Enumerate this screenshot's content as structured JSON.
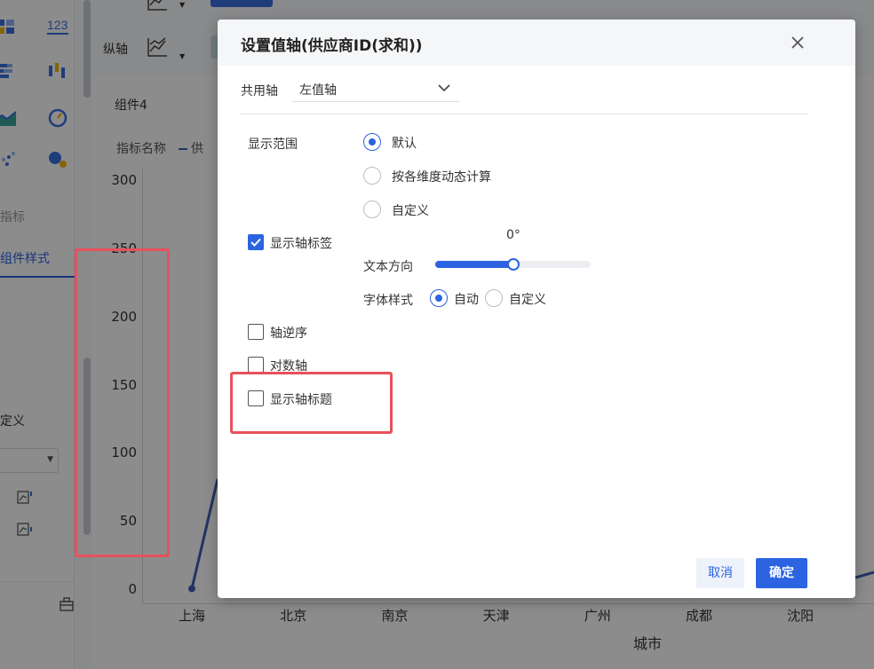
{
  "background": {
    "left_panel": {
      "chart_types_label": "123",
      "tab_metrics": "指标",
      "tab_style": "组件样式",
      "custom_text": "定义"
    },
    "config_bar": {
      "vertical_axis_label": "纵轴"
    },
    "chart": {
      "component_title": "组件4",
      "legend_label": "指标名称",
      "legend_series_prefix": "供"
    }
  },
  "chart_data": {
    "type": "line",
    "categories": [
      "上海",
      "北京",
      "南京",
      "天津",
      "广州",
      "成都",
      "沈阳"
    ],
    "xlabel": "城市",
    "ylabel": "",
    "yticks": [
      "300",
      "250",
      "200",
      "150",
      "100",
      "50",
      "0"
    ],
    "ylim": [
      0,
      300
    ],
    "series": [
      {
        "points": [
          {
            "x": "上海",
            "y": 1
          }
        ]
      }
    ],
    "line_color": "#3f5fb5"
  },
  "dialog": {
    "title": "设置值轴(供应商ID(求和))",
    "shared_axis": {
      "label": "共用轴",
      "value": "左值轴"
    },
    "display_range": {
      "label": "显示范围",
      "options": [
        "默认",
        "按各维度动态计算",
        "自定义"
      ],
      "selected": "默认"
    },
    "show_axis_labels": {
      "label": "显示轴标签",
      "checked": true
    },
    "text_direction": {
      "label": "文本方向",
      "value": "0°",
      "fraction": 0.5
    },
    "font_style": {
      "label": "字体样式",
      "options": [
        "自动",
        "自定义"
      ],
      "selected": "自动"
    },
    "axis_reverse": {
      "label": "轴逆序",
      "checked": false
    },
    "log_axis": {
      "label": "对数轴",
      "checked": false
    },
    "show_axis_title": {
      "label": "显示轴标题",
      "checked": false
    },
    "cancel_label": "取消",
    "ok_label": "确定"
  },
  "colors": {
    "accent": "#2b63e0",
    "annotation": "#e8505b"
  },
  "icons": [
    "bar-chart-icon",
    "number-icon",
    "stacked-bar-icon",
    "candlestick-icon",
    "area-chart-icon",
    "gauge-icon",
    "scatter-icon",
    "bubble-icon",
    "close-icon",
    "chevron-down-icon",
    "check-icon"
  ]
}
